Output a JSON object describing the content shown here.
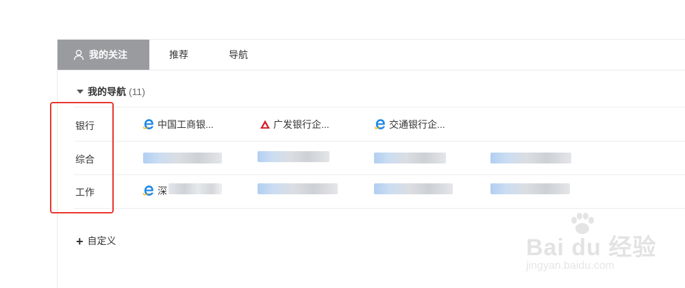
{
  "tabs": [
    {
      "label": "我的关注",
      "active": true
    },
    {
      "label": "推荐",
      "active": false
    },
    {
      "label": "导航",
      "active": false
    }
  ],
  "section": {
    "title": "我的导航",
    "count": "(11)"
  },
  "rows": [
    {
      "category": "银行",
      "links": [
        "中国工商银...",
        "广发银行企...",
        "交通银行企..."
      ]
    },
    {
      "category": "综合",
      "links": []
    },
    {
      "category": "工作",
      "links": [
        "深"
      ]
    }
  ],
  "custom_label": "自定义",
  "watermark": {
    "brand": "Bai du 经验",
    "url": "jingyan.baidu.com"
  },
  "colors": {
    "active_tab": "#999b9f",
    "highlight": "#e8332b",
    "ie_blue": "#1e88e5",
    "gf_red": "#d1232a"
  },
  "icons": {
    "tab": "person-icon",
    "link_ie": "ie-icon",
    "link_gf": "guangfa-bank-icon",
    "caret": "caret-down-icon",
    "add": "plus-icon"
  }
}
